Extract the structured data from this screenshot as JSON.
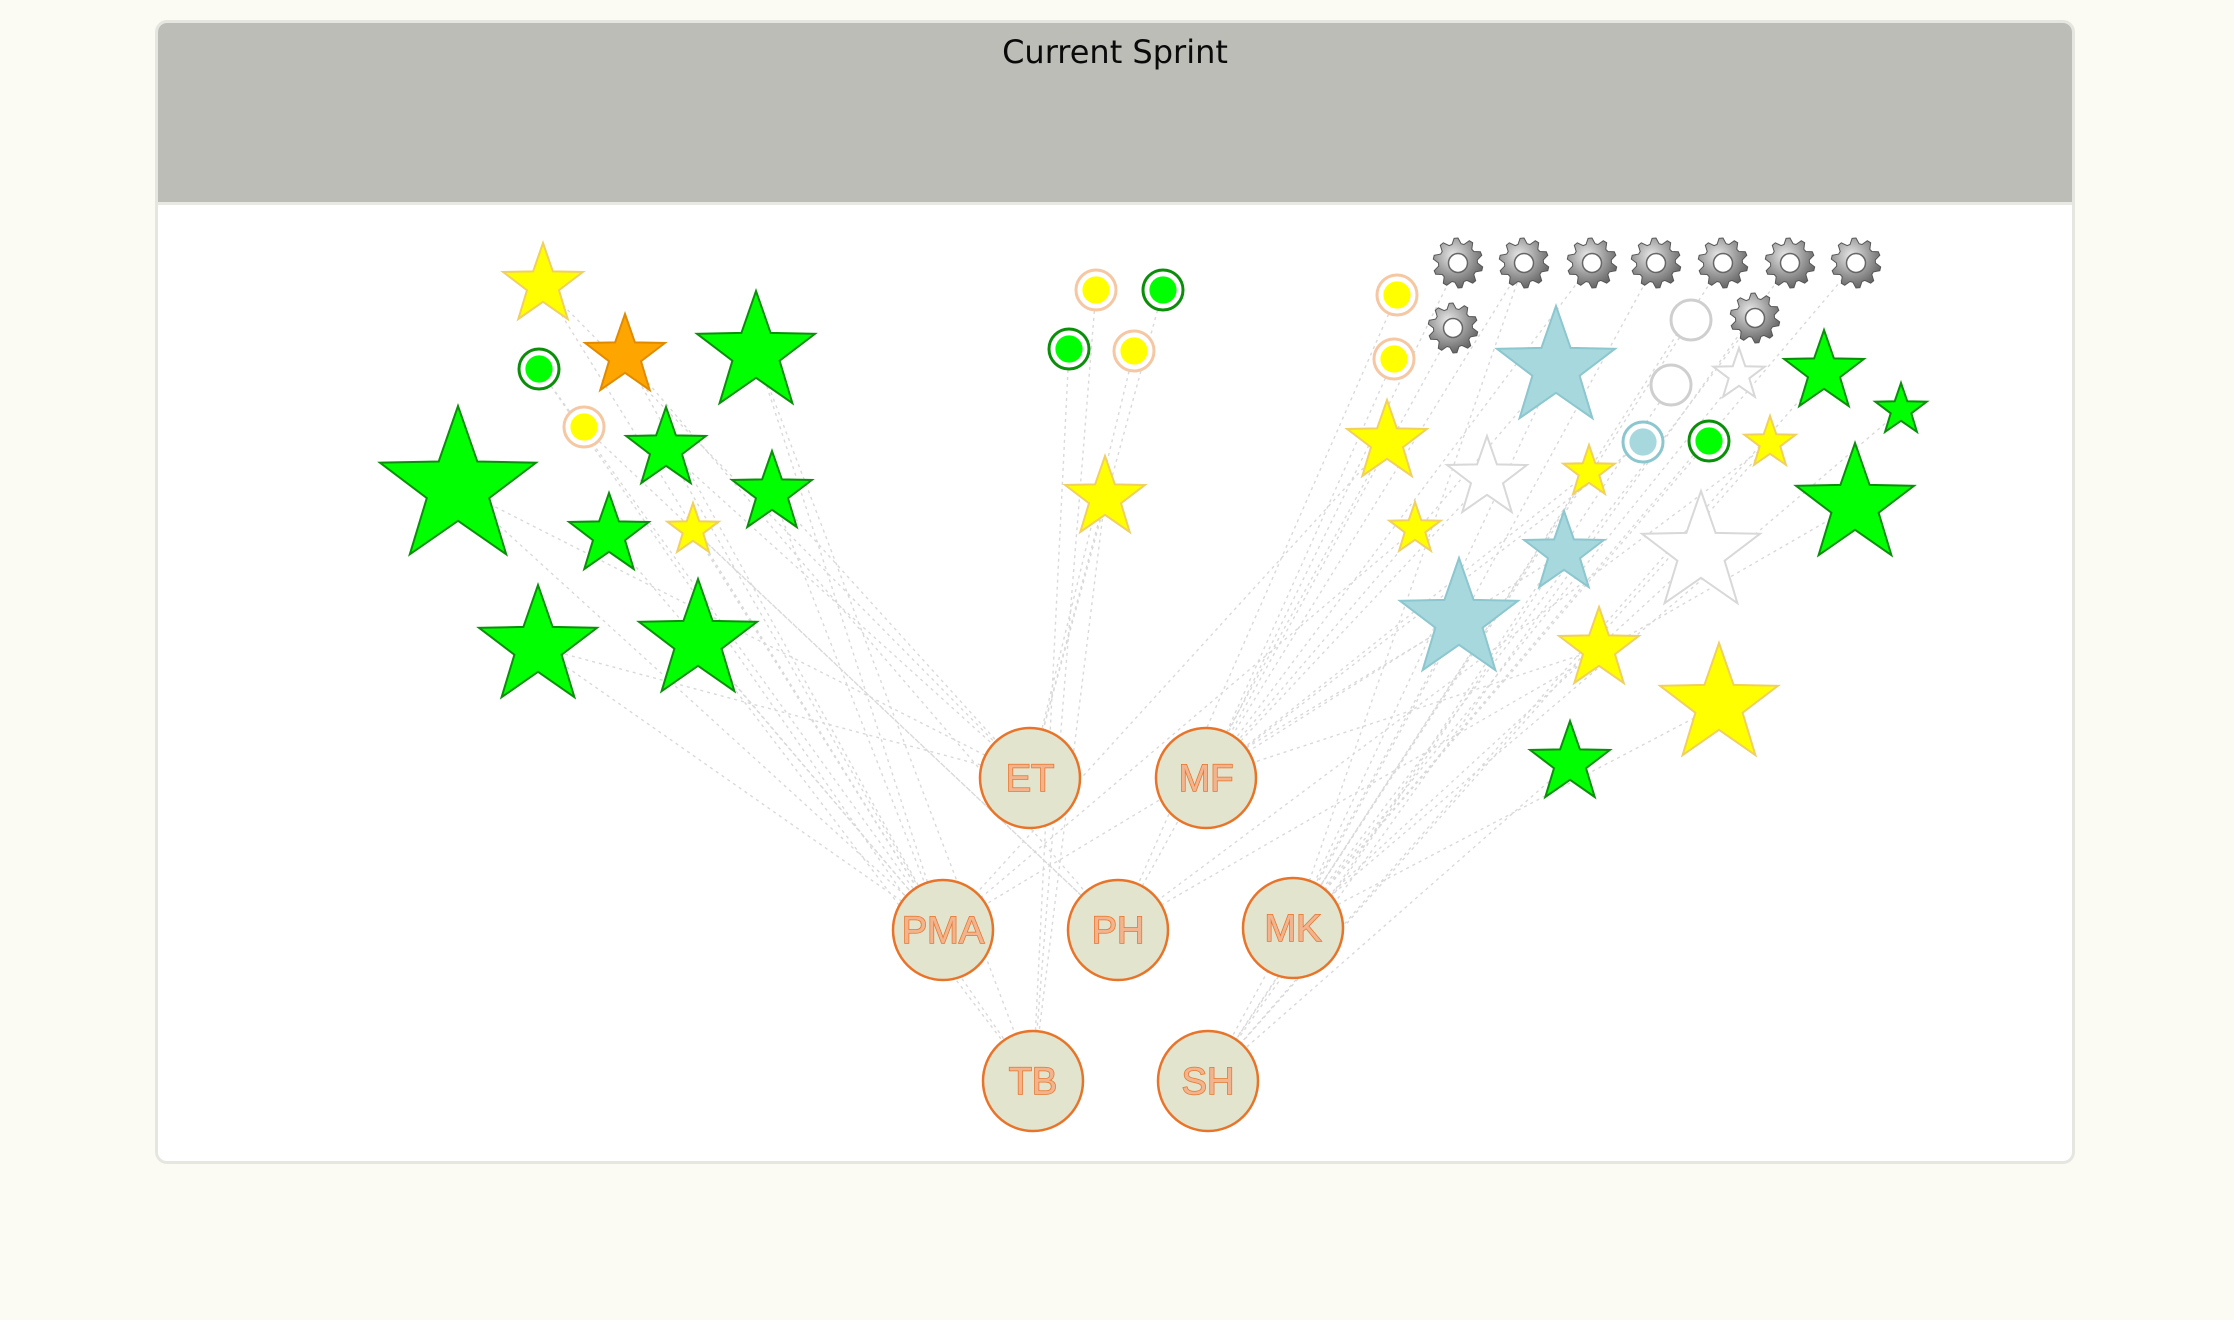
{
  "panel": {
    "title": "Current Sprint"
  },
  "colors": {
    "page_bg": "#fbfbf3",
    "header_bg": "#bcbdb6",
    "done": "#00ff00",
    "in_progress": "#ffff00",
    "blocked": "#ffa500",
    "review": "#a7d8de",
    "not_started": "#ffffff",
    "member_fill": "#e2e4cd",
    "member_stroke": "#e8742a"
  },
  "members": [
    {
      "initials": "ET"
    },
    {
      "initials": "MF"
    },
    {
      "initials": "PMA"
    },
    {
      "initials": "PH"
    },
    {
      "initials": "MK"
    },
    {
      "initials": "TB"
    },
    {
      "initials": "SH"
    }
  ],
  "work_items": {
    "left_cluster": [
      {
        "kind": "star",
        "status": "in_progress"
      },
      {
        "kind": "star",
        "status": "blocked"
      },
      {
        "kind": "star",
        "status": "done"
      },
      {
        "kind": "ring",
        "status": "done"
      },
      {
        "kind": "ring",
        "status": "in_progress"
      },
      {
        "kind": "star",
        "status": "done"
      },
      {
        "kind": "star",
        "status": "done"
      },
      {
        "kind": "star",
        "status": "done"
      },
      {
        "kind": "star",
        "status": "done"
      },
      {
        "kind": "star",
        "status": "in_progress"
      },
      {
        "kind": "star",
        "status": "done"
      },
      {
        "kind": "star",
        "status": "done"
      }
    ],
    "middle_cluster": [
      {
        "kind": "ring",
        "status": "in_progress"
      },
      {
        "kind": "ring",
        "status": "done"
      },
      {
        "kind": "ring",
        "status": "done"
      },
      {
        "kind": "ring",
        "status": "in_progress"
      },
      {
        "kind": "star",
        "status": "in_progress"
      }
    ],
    "right_cluster": [
      {
        "kind": "gear",
        "status": "task"
      },
      {
        "kind": "gear",
        "status": "task"
      },
      {
        "kind": "gear",
        "status": "task"
      },
      {
        "kind": "gear",
        "status": "task"
      },
      {
        "kind": "gear",
        "status": "task"
      },
      {
        "kind": "gear",
        "status": "task"
      },
      {
        "kind": "gear",
        "status": "task"
      },
      {
        "kind": "gear",
        "status": "task"
      },
      {
        "kind": "gear",
        "status": "task"
      },
      {
        "kind": "ring",
        "status": "in_progress"
      },
      {
        "kind": "ring",
        "status": "in_progress"
      },
      {
        "kind": "ring",
        "status": "not_started"
      },
      {
        "kind": "ring",
        "status": "not_started"
      },
      {
        "kind": "ring",
        "status": "review"
      },
      {
        "kind": "ring",
        "status": "done"
      },
      {
        "kind": "star",
        "status": "review"
      },
      {
        "kind": "star",
        "status": "not_started"
      },
      {
        "kind": "star",
        "status": "done"
      },
      {
        "kind": "star",
        "status": "done"
      },
      {
        "kind": "star",
        "status": "in_progress"
      },
      {
        "kind": "star",
        "status": "not_started"
      },
      {
        "kind": "star",
        "status": "in_progress"
      },
      {
        "kind": "star",
        "status": "in_progress"
      },
      {
        "kind": "star",
        "status": "in_progress"
      },
      {
        "kind": "star",
        "status": "review"
      },
      {
        "kind": "star",
        "status": "not_started"
      },
      {
        "kind": "star",
        "status": "done"
      },
      {
        "kind": "star",
        "status": "review"
      },
      {
        "kind": "star",
        "status": "in_progress"
      },
      {
        "kind": "star",
        "status": "in_progress"
      },
      {
        "kind": "star",
        "status": "done"
      }
    ]
  }
}
